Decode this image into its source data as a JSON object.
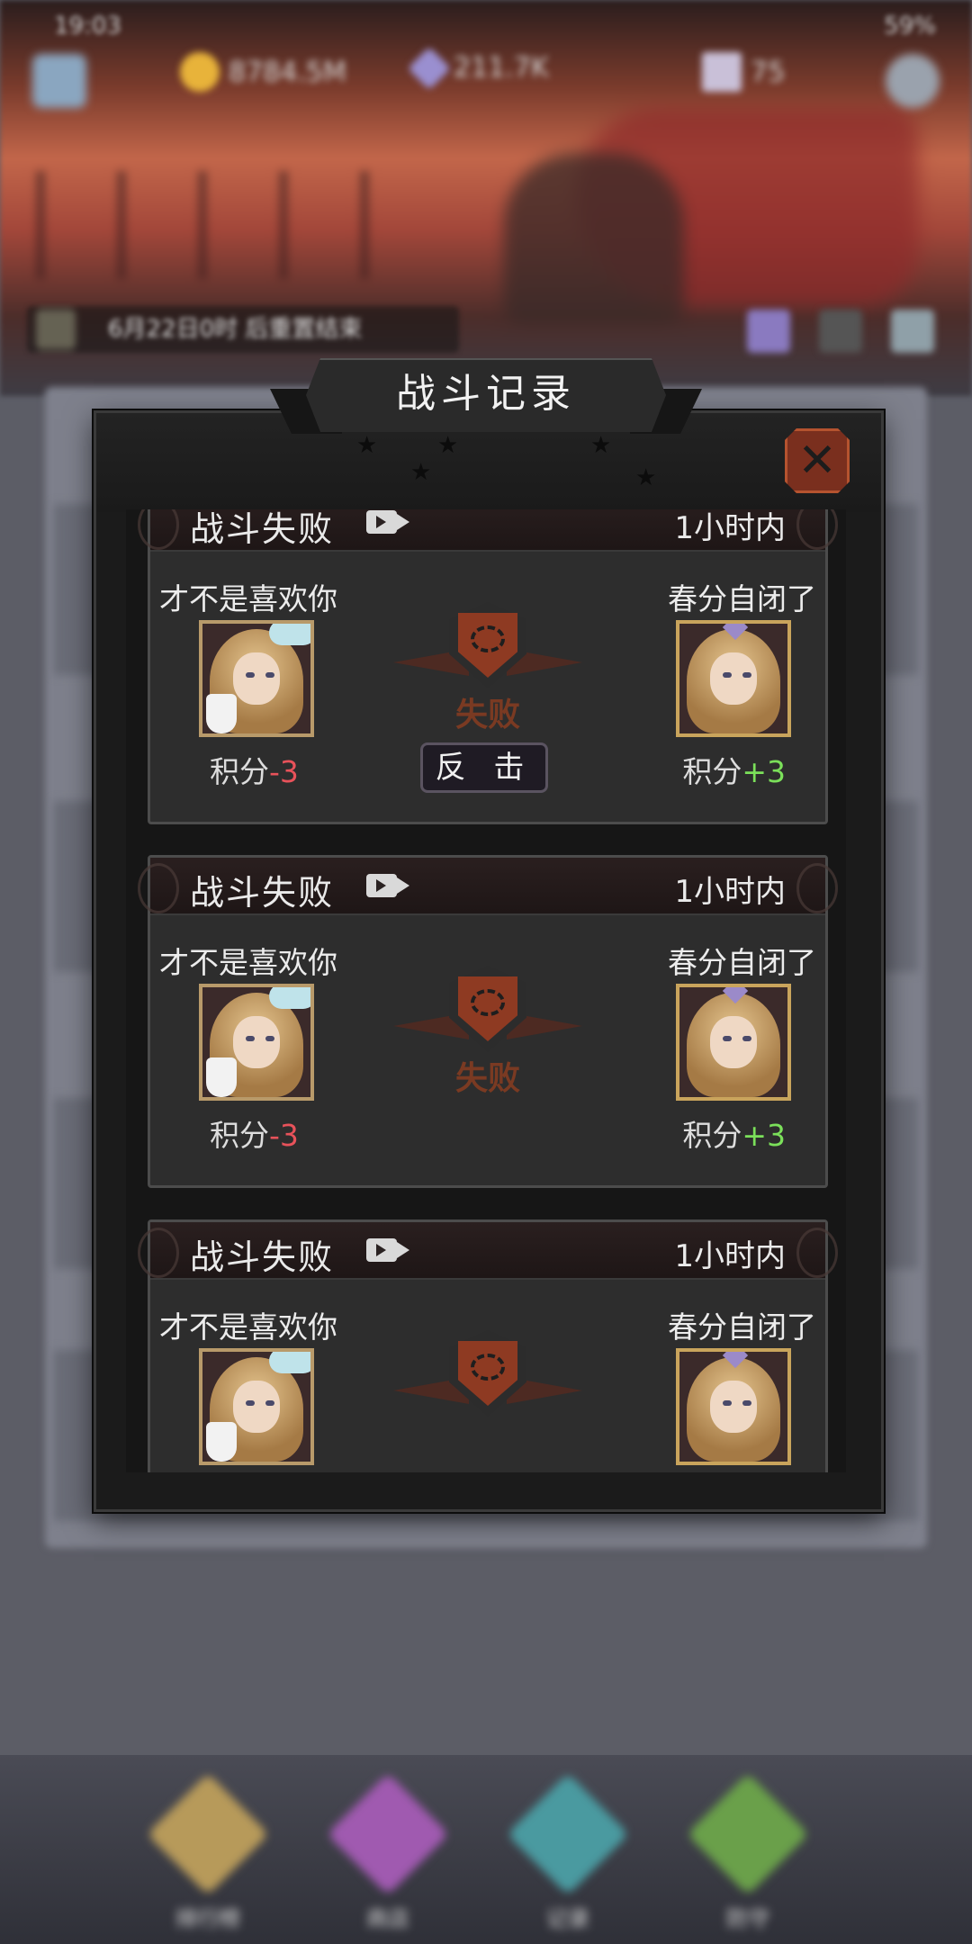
{
  "status_bar": {
    "time": "19:03",
    "battery": "59%"
  },
  "resources": {
    "gold": "8784.5M",
    "gems": "211.7K",
    "stamina": "75"
  },
  "background_notice": "6月22日0时 后重置结束",
  "tabs": [
    {
      "label": "排行榜",
      "color": "#b79a5a"
    },
    {
      "label": "商店",
      "color": "#a05ab0"
    },
    {
      "label": "记录",
      "color": "#4a9aa0"
    },
    {
      "label": "防守",
      "color": "#6aa04a"
    }
  ],
  "modal": {
    "title": "战斗记录",
    "close_icon": "close-x-icon",
    "records": [
      {
        "result": "战斗失败",
        "time": "1小时内",
        "player_left": {
          "name": "才不是喜欢你",
          "score_label": "积分",
          "score_delta": "-3"
        },
        "player_right": {
          "name": "春分自闭了",
          "score_label": "积分",
          "score_delta": "+3"
        },
        "emblem_label": "失败",
        "counterattack_label": "反 击"
      },
      {
        "result": "战斗失败",
        "time": "1小时内",
        "player_left": {
          "name": "才不是喜欢你",
          "score_label": "积分",
          "score_delta": "-3"
        },
        "player_right": {
          "name": "春分自闭了",
          "score_label": "积分",
          "score_delta": "+3"
        },
        "emblem_label": "失败"
      },
      {
        "result": "战斗失败",
        "time": "1小时内",
        "player_left": {
          "name": "才不是喜欢你"
        },
        "player_right": {
          "name": "春分自闭了"
        }
      }
    ]
  },
  "colors": {
    "loss": "#e8525a",
    "gain": "#7be05a",
    "accent": "#8e3a22"
  }
}
